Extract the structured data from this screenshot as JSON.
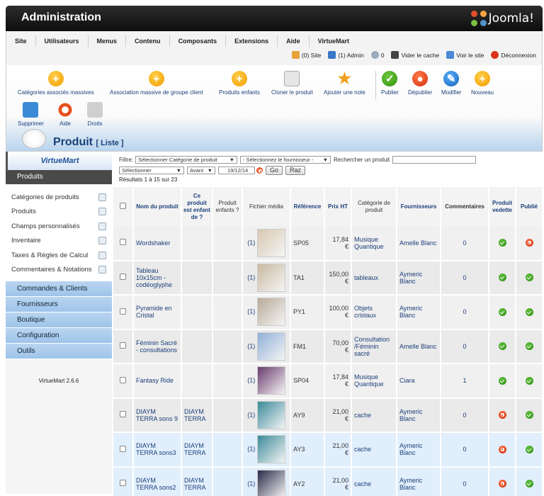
{
  "header": {
    "title": "Administration",
    "logo_text": "Joomla!"
  },
  "menus": [
    "Site",
    "Utilisateurs",
    "Menus",
    "Contenu",
    "Composants",
    "Extensions",
    "Aide",
    "VirtueMart"
  ],
  "status": {
    "site": "(0) Site",
    "admin": "(1) Admin",
    "messages": "0",
    "clear_cache": "Vider le cache",
    "view_site": "Voir le site",
    "logout": "Déconnexion"
  },
  "toolbar": {
    "assoc_categories": "Catégories associés massives",
    "assoc_group": "Association massive de groupe client",
    "child_products": "Produits enfants",
    "clone": "Cloner le produit",
    "add_note": "Ajouter une note",
    "publish": "Publier",
    "unpublish": "Dépublier",
    "edit": "Modifier",
    "new": "Nouveau",
    "delete": "Supprimer",
    "help": "Aide",
    "rights": "Droits"
  },
  "page": {
    "title": "Produit",
    "subtitle": "[ Liste ]"
  },
  "sidebar": {
    "logo": "VirtueMart",
    "section": "Produits",
    "items": [
      "Catégories de produits",
      "Produits",
      "Champs personnalisés",
      "Inventaire",
      "Taxes & Règles de Calcul",
      "Commentaires & Notations"
    ],
    "sections": [
      "Commandes & Clients",
      "Fournisseurs",
      "Boutique",
      "Configuration",
      "Outils"
    ],
    "version": "VirtueMart 2.6.6"
  },
  "filter": {
    "label": "Filtre:",
    "category": "Sélectionner Catégorie de produit",
    "supplier": "- Sélectionnez le fournisseur -",
    "search_label": "Rechercher un produit",
    "select": "Sélectionner",
    "before": "Avant",
    "date": "19/12/14",
    "go": "Go",
    "reset": "Raz",
    "results": "Résultats 1 à 15 sur 23"
  },
  "table": {
    "headers": [
      "",
      "Nom du produit",
      "Ce produit est enfant de ?",
      "Produit enfants ?",
      "Fichier média",
      "Référence",
      "Prix HT",
      "Catégorie de produit",
      "Fournisseurs",
      "Commentaires",
      "Produit vedette",
      "Publié"
    ],
    "rows": [
      {
        "name": "Wordshaker",
        "parent": "",
        "media": "(1)",
        "ref": "SP05",
        "price": "17,84 €",
        "category": "Musique Quantique",
        "supplier": "Amelle Blanc",
        "comments": "0",
        "featured": true,
        "published": false,
        "thumb": "#d8c8b0"
      },
      {
        "name": "Tableau 10x15cm - codéoglyphe",
        "parent": "",
        "media": "(1)",
        "ref": "TA1",
        "price": "150,00 €",
        "category": "tableaux",
        "supplier": "Aymeric Blanc",
        "comments": "0",
        "featured": true,
        "published": true,
        "thumb": "#c9b9a0"
      },
      {
        "name": "Pyramide en Cristal",
        "parent": "",
        "media": "(1)",
        "ref": "PY1",
        "price": "100,00 €",
        "category": "Objets cristaux",
        "supplier": "Aymeric Blanc",
        "comments": "0",
        "featured": true,
        "published": true,
        "thumb": "#b8aa98"
      },
      {
        "name": "Féminin Sacré - consultations",
        "parent": "",
        "media": "(1)",
        "ref": "FM1",
        "price": "70,00 €",
        "category": "Consultation /Féminin sacré",
        "supplier": "Amelle Blanc",
        "comments": "0",
        "featured": true,
        "published": true,
        "thumb": "#8fb0d8"
      },
      {
        "name": "Fantasy Ride",
        "parent": "",
        "media": "(1)",
        "ref": "SP04",
        "price": "17,84 €",
        "category": "Musique Quantique",
        "supplier": "Ciara",
        "comments": "1",
        "featured": true,
        "published": true,
        "thumb": "#6a3a6e"
      },
      {
        "name": "DIAYM TERRA sons 9",
        "parent": "DIAYM TERRA",
        "media": "(1)",
        "ref": "AY9",
        "price": "21,00 €",
        "category": "cache",
        "supplier": "Aymeric Blanc",
        "comments": "0",
        "featured": false,
        "published": true,
        "thumb": "#3a8a9a"
      },
      {
        "name": "DIAYM TERRA sons3",
        "parent": "DIAYM TERRA",
        "media": "(1)",
        "ref": "AY3",
        "price": "21,00 €",
        "category": "cache",
        "supplier": "Aymeric Blanc",
        "comments": "0",
        "featured": false,
        "published": true,
        "thumb": "#3a8a9a"
      },
      {
        "name": "DIAYM TERRA sons2",
        "parent": "DIAYM TERRA",
        "media": "(1)",
        "ref": "AY2",
        "price": "21,00 €",
        "category": "cache",
        "supplier": "Aymeric Blanc",
        "comments": "0",
        "featured": false,
        "published": true,
        "thumb": "#2a2a4a"
      }
    ]
  }
}
